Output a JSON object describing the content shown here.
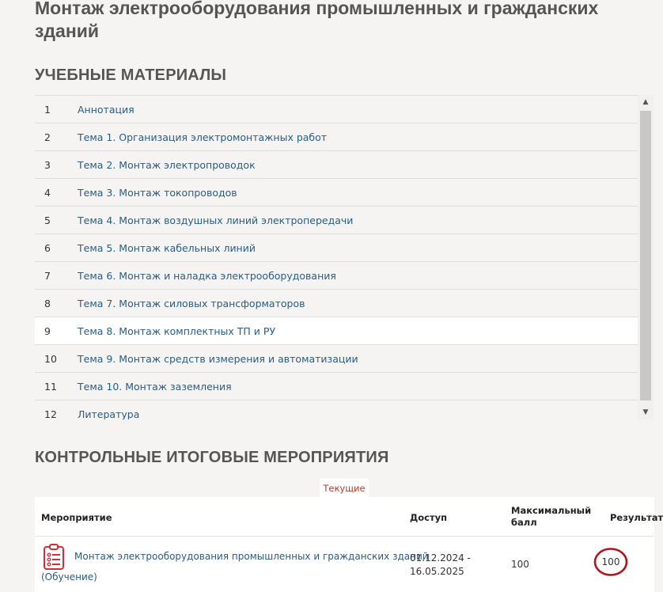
{
  "course": {
    "title": "Монтаж электрооборудования промышленных и гражданских зданий"
  },
  "materials": {
    "heading": "УЧЕБНЫЕ МАТЕРИАЛЫ",
    "selected_index": 8,
    "items": [
      {
        "num": "1",
        "label": "Аннотация"
      },
      {
        "num": "2",
        "label": "Тема 1. Организация электромонтажных работ"
      },
      {
        "num": "3",
        "label": "Тема 2. Монтаж электропроводок"
      },
      {
        "num": "4",
        "label": "Тема 3. Монтаж токопроводов"
      },
      {
        "num": "5",
        "label": "Тема 4. Монтаж воздушных линий электропередачи"
      },
      {
        "num": "6",
        "label": "Тема 5. Монтаж кабельных линий"
      },
      {
        "num": "7",
        "label": "Тема 6. Монтаж и наладка электрооборудования"
      },
      {
        "num": "8",
        "label": "Тема 7. Монтаж силовых трансформаторов"
      },
      {
        "num": "9",
        "label": "Тема 8. Монтаж комплектных ТП и РУ"
      },
      {
        "num": "10",
        "label": "Тема 9. Монтаж средств измерения и автоматизации"
      },
      {
        "num": "11",
        "label": "Тема 10. Монтаж заземления"
      },
      {
        "num": "12",
        "label": "Литература"
      }
    ],
    "scroll_up_icon": "▲",
    "scroll_down_icon": "▼"
  },
  "events": {
    "heading": "КОНТРОЛЬНЫЕ ИТОГОВЫЕ МЕРОПРИЯТИЯ",
    "tab_current": "Текущие",
    "columns": {
      "event": "Мероприятие",
      "access": "Доступ",
      "max_score": "Максимальный балл",
      "result": "Результат"
    },
    "rows": [
      {
        "icon": "clipboard-checklist-icon",
        "name": "Монтаж электрооборудования промышленных и гражданских зданий",
        "sub": "(Обучение)",
        "access_from": "01.12.2024 -",
        "access_to": "16.05.2025",
        "max_score": "100",
        "result": "100"
      }
    ]
  },
  "colors": {
    "link": "#2a5d84",
    "accent_red": "#c0392b",
    "annotation_circle": "#b3121a",
    "background": "#f5f4f2"
  }
}
